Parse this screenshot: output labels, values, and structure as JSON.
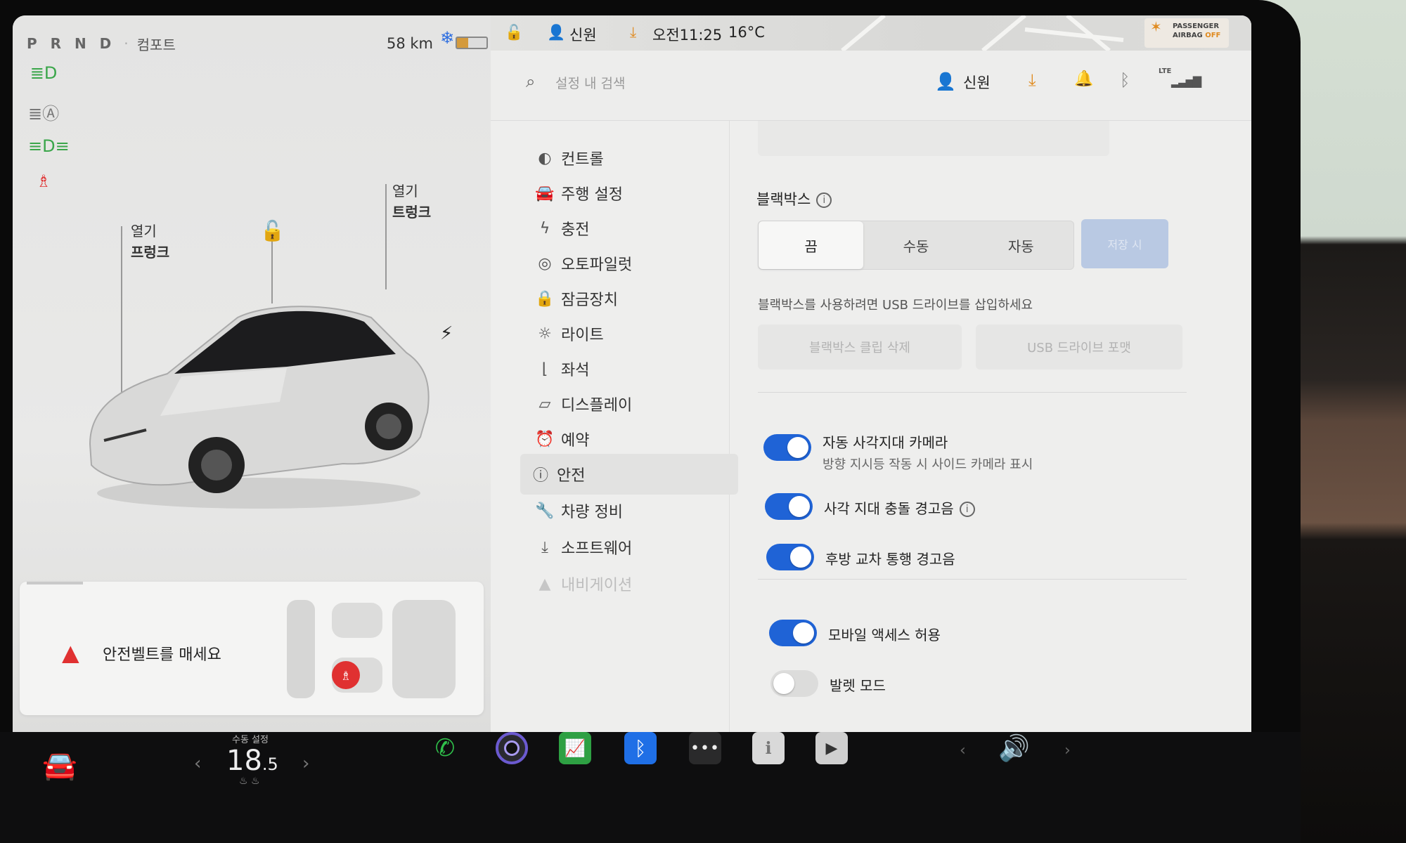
{
  "status": {
    "prnd": "P R N D",
    "drive_mode": "컴포트",
    "range": "58 km",
    "user": "신원",
    "time": "오전11:25",
    "temperature": "16°C",
    "airbag_line1": "PASSENGER",
    "airbag_line2": "AIRBAG",
    "airbag_state": "OFF"
  },
  "car_panel": {
    "frunk_action": "열기",
    "frunk_label": "프렁크",
    "trunk_action": "열기",
    "trunk_label": "트렁크",
    "seatbelt_warning": "안전벨트를 매세요"
  },
  "settings": {
    "search_placeholder": "설정 내 검색",
    "user": "신원",
    "lte": "LTE",
    "nav": [
      {
        "label": "컨트롤",
        "icon": "toggle-icon"
      },
      {
        "label": "주행 설정",
        "icon": "car-icon"
      },
      {
        "label": "충전",
        "icon": "bolt-icon"
      },
      {
        "label": "오토파일럿",
        "icon": "steering-wheel-icon"
      },
      {
        "label": "잠금장치",
        "icon": "lock-icon"
      },
      {
        "label": "라이트",
        "icon": "light-icon"
      },
      {
        "label": "좌석",
        "icon": "seat-icon"
      },
      {
        "label": "디스플레이",
        "icon": "display-icon"
      },
      {
        "label": "예약",
        "icon": "alarm-icon"
      },
      {
        "label": "안전",
        "icon": "safety-icon"
      },
      {
        "label": "차량 정비",
        "icon": "wrench-icon"
      },
      {
        "label": "소프트웨어",
        "icon": "download-icon"
      },
      {
        "label": "내비게이션",
        "icon": "navigation-icon"
      }
    ],
    "active_nav": "안전",
    "dashcam": {
      "title": "블랙박스",
      "options": [
        "끔",
        "수동",
        "자동"
      ],
      "selected": "끔",
      "save_button": "저장 시",
      "hint": "블랙박스를 사용하려면 USB 드라이브를 삽입하세요",
      "delete_clips": "블랙박스 클립 삭제",
      "format_usb": "USB 드라이브 포맷"
    },
    "toggles": [
      {
        "label": "자동 사각지대 카메라",
        "sub": "방향 지시등 작동 시 사이드 카메라 표시",
        "on": true
      },
      {
        "label": "사각 지대 충돌 경고음",
        "on": true
      },
      {
        "label": "후방 교차 통행 경고음",
        "on": true
      },
      {
        "label": "모바일 액세스 허용",
        "on": true
      },
      {
        "label": "발렛 모드",
        "on": false
      }
    ]
  },
  "dock": {
    "temp_label": "수동 설정",
    "temp_whole": "18",
    "temp_decimal": ".5"
  },
  "colors": {
    "toggle_on": "#1f63d6",
    "accent_orange": "#e08a1e",
    "warning_red": "#e03131",
    "headlight_green": "#3aa64a"
  }
}
